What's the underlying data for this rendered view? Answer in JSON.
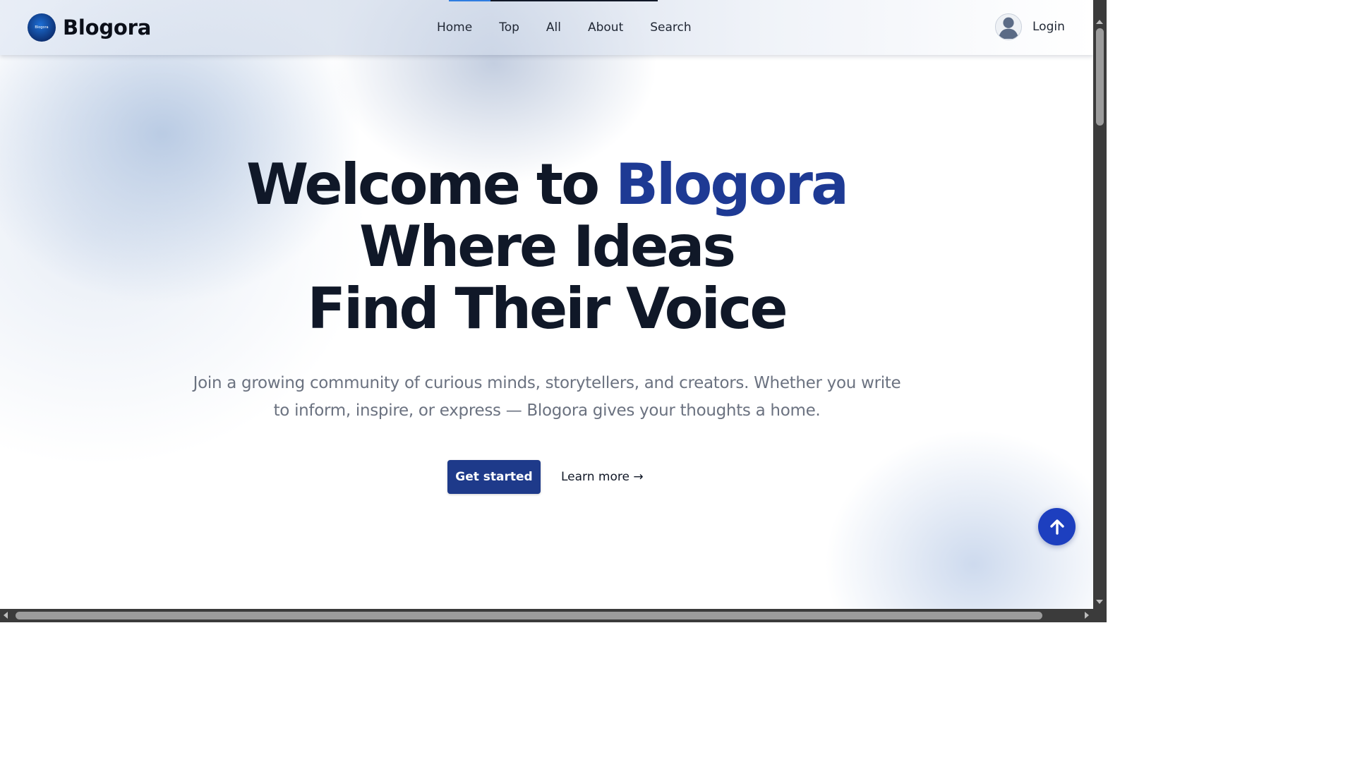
{
  "brand": {
    "name": "Blogora",
    "logo_text": "Blogora",
    "logo_icon": "blogora-logo-icon"
  },
  "nav": {
    "items": [
      {
        "label": "Home"
      },
      {
        "label": "Top"
      },
      {
        "label": "All"
      },
      {
        "label": "About"
      },
      {
        "label": "Search"
      }
    ],
    "scroll_progress": 0.2
  },
  "user": {
    "avatar_icon": "user-avatar-icon",
    "login_label": "Login"
  },
  "hero": {
    "title_line1_prefix": "Welcome to ",
    "title_line1_accent": "Blogora",
    "title_line2": "Where Ideas",
    "title_line3": "Find Their Voice",
    "subtitle": "Join a growing community of curious minds, storytellers, and creators. Whether you write to inform, inspire, or express — Blogora gives your thoughts a home.",
    "primary_button": "Get started",
    "secondary_link": "Learn more →"
  },
  "scroll_top_icon": "arrow-up-icon",
  "colors": {
    "accent": "#1e3a94",
    "primary_button": "#1e3a8a",
    "fab": "#1d3fbf",
    "heading": "#101828",
    "body_text": "#6b7280"
  }
}
